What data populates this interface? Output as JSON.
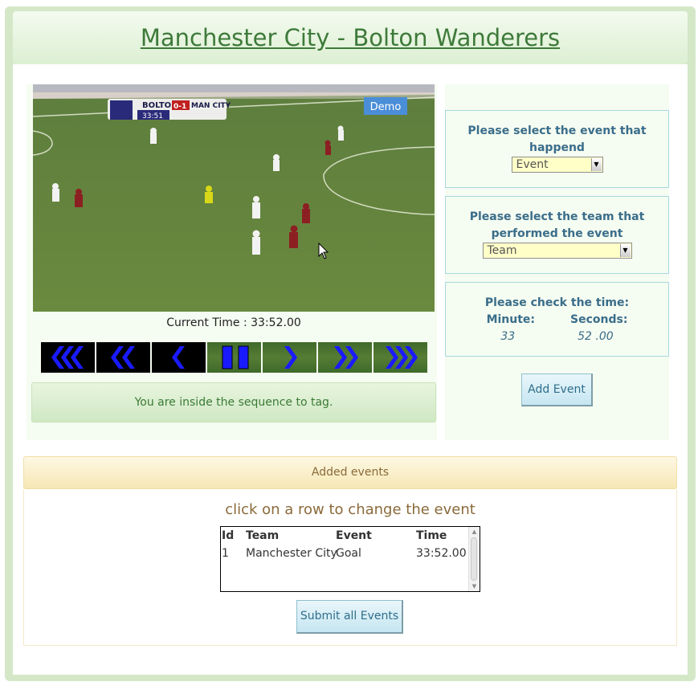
{
  "header": {
    "title": "Manchester City - Bolton Wanderers"
  },
  "video": {
    "badge": "Demo",
    "score_home": "BOLTON",
    "score": "0-1",
    "score_away": "MAN CITY",
    "clock": "33:51",
    "current_time_label": "Current Time : 33:52.00"
  },
  "controls": [
    {
      "name": "rewind-fast",
      "icon": "triple-chevron-left-icon"
    },
    {
      "name": "rewind",
      "icon": "double-chevron-left-icon"
    },
    {
      "name": "step-back",
      "icon": "chevron-left-icon"
    },
    {
      "name": "pause",
      "icon": "pause-icon"
    },
    {
      "name": "play",
      "icon": "chevron-right-icon"
    },
    {
      "name": "forward",
      "icon": "double-chevron-right-icon"
    },
    {
      "name": "forward-fast",
      "icon": "triple-chevron-right-icon"
    }
  ],
  "status_message": "You are inside the sequence to tag.",
  "event_box": {
    "question_line1": "Please select the event that",
    "question_line2": "happend",
    "selected": "Event"
  },
  "team_box": {
    "question_line1": "Please select the team that",
    "question_line2": "performed the event",
    "selected": "Team"
  },
  "time_box": {
    "question": "Please check the time:",
    "minute_label": "Minute:",
    "seconds_label": "Seconds:",
    "minute_value": "33",
    "seconds_value": "52 .00"
  },
  "add_event_label": "Add Event",
  "events_panel": {
    "heading": "Added events",
    "instruction": "click on a row to change the event",
    "columns": [
      "Id",
      "Team",
      "Event",
      "Time"
    ],
    "rows": [
      {
        "id": "1",
        "team": "Manchester City",
        "event": "Goal",
        "time": "33:52.00"
      }
    ]
  },
  "submit_label": "Submit all Events",
  "colors": {
    "control_arrow": "#1a1aff",
    "title_green": "#3e7a3a",
    "question_blue": "#3a6d8a"
  }
}
